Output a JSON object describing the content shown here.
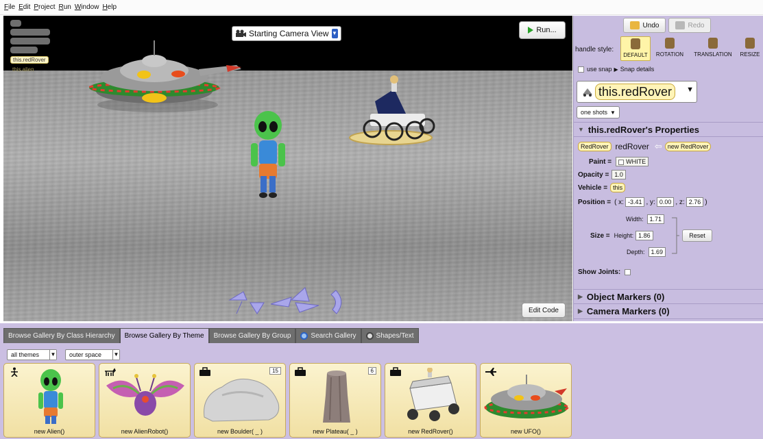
{
  "menu": {
    "items": [
      {
        "key": "F",
        "rest": "ile"
      },
      {
        "key": "E",
        "rest": "dit"
      },
      {
        "key": "P",
        "rest": "roject"
      },
      {
        "key": "R",
        "rest": "un"
      },
      {
        "key": "W",
        "rest": "indow"
      },
      {
        "key": "H",
        "rest": "elp"
      }
    ]
  },
  "scene": {
    "object_labels": [
      "this.redRover",
      "this.alien"
    ],
    "camera_view": "Starting Camera View",
    "run_label": "Run...",
    "edit_code_label": "Edit Code"
  },
  "panel": {
    "undo_label": "Undo",
    "redo_label": "Redo",
    "handle_style_label": "handle style:",
    "handle_options": [
      "DEFAULT",
      "ROTATION",
      "TRANSLATION",
      "RESIZE"
    ],
    "use_snap_label": "use snap",
    "snap_details_label": "Snap details",
    "selected_object": "this.redRover",
    "one_shots_label": "one shots",
    "properties_title": "this.redRover's Properties",
    "type_tile": "RedRover",
    "instance_name": "redRover",
    "new_tile_new": "new",
    "new_tile_type": "RedRover",
    "paint_label": "Paint =",
    "paint_value": "WHITE",
    "opacity_label": "Opacity =",
    "opacity_value": "1.0",
    "vehicle_label": "Vehicle =",
    "vehicle_value": "this",
    "position_label": "Position =",
    "position_open": "( x:",
    "position_x": "-3.41",
    "position_y_label": ", y:",
    "position_y": "0.00",
    "position_z_label": ", z:",
    "position_z": "2.76",
    "position_close": ")",
    "size_label": "Size =",
    "width_label": "Width:",
    "width_value": "1.71",
    "height_label": "Height:",
    "height_value": "1.86",
    "depth_label": "Depth:",
    "depth_value": "1.69",
    "reset_label": "Reset",
    "show_joints_label": "Show Joints:",
    "object_markers_label": "Object Markers (0)",
    "camera_markers_label": "Camera Markers (0)"
  },
  "gallery": {
    "tabs": [
      "Browse Gallery By Class Hierarchy",
      "Browse Gallery By Theme",
      "Browse Gallery By Group",
      "Search Gallery",
      "Shapes/Text"
    ],
    "active_tab": 1,
    "theme_filter": "all themes",
    "subtheme_filter": "outer space",
    "cards": [
      {
        "label": "new Alien()",
        "icon": "person-icon",
        "count": ""
      },
      {
        "label": "new AlienRobot()",
        "icon": "quadruped-icon",
        "count": ""
      },
      {
        "label": "new Boulder( _ )",
        "icon": "prop-icon",
        "count": "15"
      },
      {
        "label": "new Plateau( _ )",
        "icon": "prop-icon",
        "count": "6"
      },
      {
        "label": "new RedRover()",
        "icon": "prop-icon",
        "count": ""
      },
      {
        "label": "new UFO()",
        "icon": "flyer-icon",
        "count": ""
      }
    ]
  },
  "colors": {
    "panel_bg": "#c8bde0",
    "tile_bg": "#fff4b8",
    "card_bg": "#f5e8b4",
    "run_green": "#2aa12a"
  }
}
